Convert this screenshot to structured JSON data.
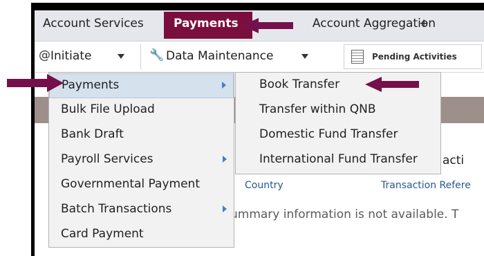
{
  "tabs": {
    "account_services": "Account Services",
    "payments": "Payments",
    "account_aggregation": "Account Aggregation",
    "add": "+"
  },
  "toolbar": {
    "initiate": "Initiate",
    "data_maintenance": "Data Maintenance",
    "pending_activities": "Pending Activities"
  },
  "content": {
    "columns": [
      "Country",
      "Transaction Refere"
    ],
    "partial_col": "acti",
    "message": "ummary information is not available. T"
  },
  "menu": {
    "items": [
      {
        "label": "Payments",
        "submenu": true,
        "highlighted": true
      },
      {
        "label": "Bulk File Upload",
        "submenu": false
      },
      {
        "label": "Bank Draft",
        "submenu": false
      },
      {
        "label": "Payroll Services",
        "submenu": true
      },
      {
        "label": "Governmental Payment",
        "submenu": false
      },
      {
        "label": "Batch Transactions",
        "submenu": true
      },
      {
        "label": "Card Payment",
        "submenu": false
      }
    ]
  },
  "submenu": {
    "items": [
      {
        "label": "Book Transfer"
      },
      {
        "label": "Transfer within QNB"
      },
      {
        "label": "Domestic Fund Transfer"
      },
      {
        "label": "International Fund Transfer"
      }
    ]
  },
  "colors": {
    "accent": "#7a0f3d",
    "annotation_arrow": "#74114a",
    "highlight": "#d6e1ee",
    "link": "#27588f"
  }
}
